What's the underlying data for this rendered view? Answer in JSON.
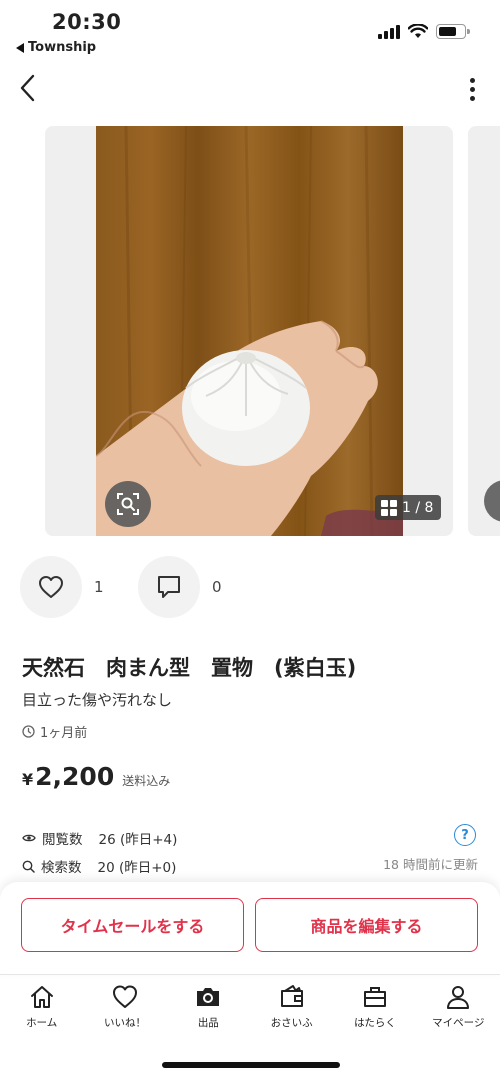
{
  "status": {
    "time": "20:30",
    "back_app": "Township"
  },
  "gallery": {
    "counter": "1 / 8"
  },
  "actions": {
    "likes": "1",
    "comments": "0"
  },
  "item": {
    "title": "天然石　肉まん型　置物　(紫白玉)",
    "condition": "目立った傷や汚れなし",
    "posted": "1ヶ月前",
    "currency": "¥",
    "price": "2,200",
    "shipping": "送料込み"
  },
  "stats": {
    "views_label": "閲覧数",
    "views_value": "26 (昨日+4)",
    "search_label": "検索数",
    "search_value": "20 (昨日+0)",
    "help": "?",
    "updated": "18 時間前に更新"
  },
  "buttons": {
    "time_sale": "タイムセールをする",
    "edit": "商品を編集する"
  },
  "tabs": [
    {
      "label": "ホーム",
      "icon": "home-icon"
    },
    {
      "label": "いいね！",
      "icon": "heart-icon"
    },
    {
      "label": "出品",
      "icon": "camera-icon"
    },
    {
      "label": "おさいふ",
      "icon": "wallet-icon"
    },
    {
      "label": "はたらく",
      "icon": "briefcase-icon"
    },
    {
      "label": "マイページ",
      "icon": "person-icon"
    }
  ],
  "colors": {
    "accent": "#e0334b",
    "link": "#2b8ad6"
  }
}
